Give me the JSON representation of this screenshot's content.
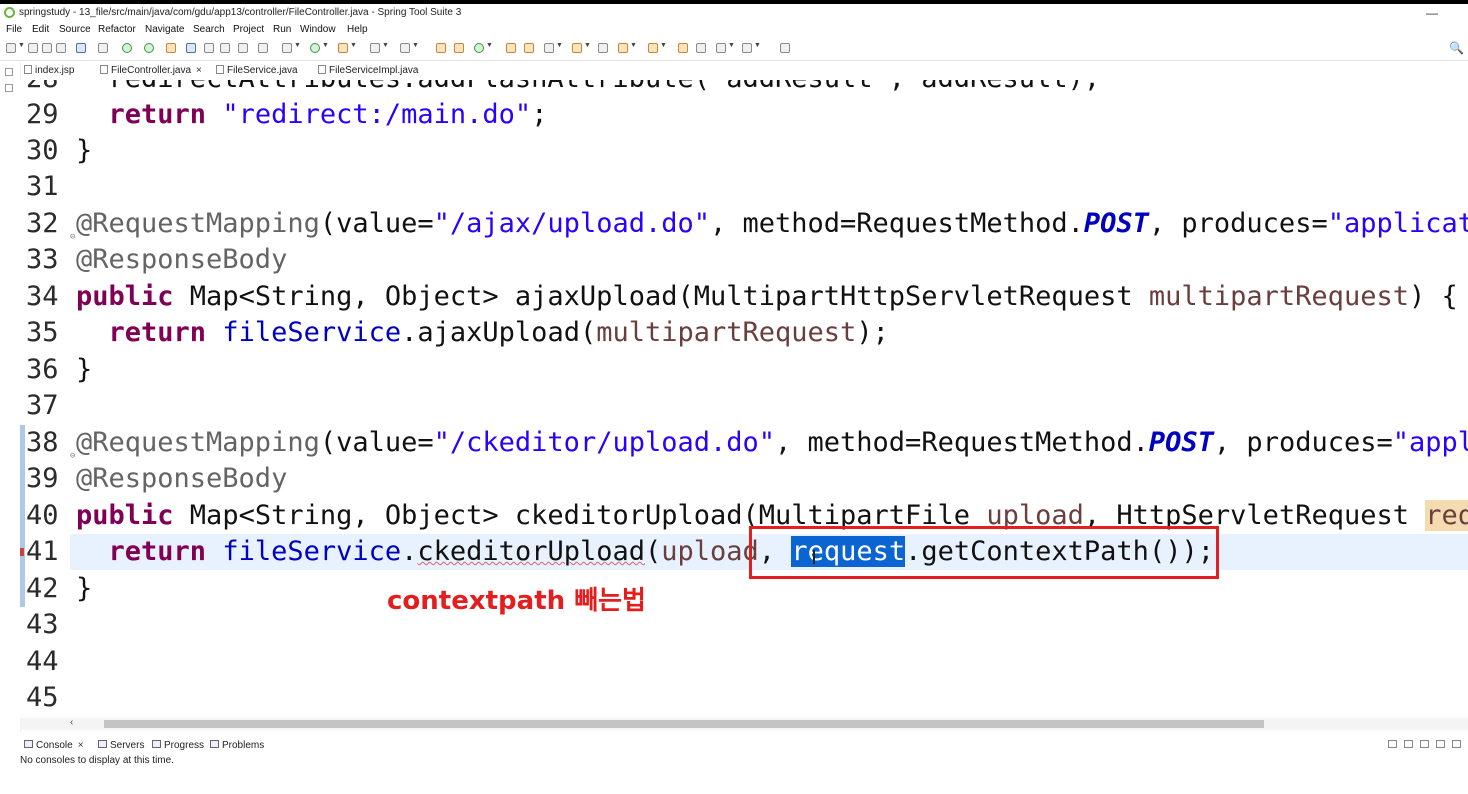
{
  "window": {
    "title": "springstudy - 13_file/src/main/java/com/gdu/app13/controller/FileController.java - Spring Tool Suite 3",
    "minimize_glyph": "—"
  },
  "menu": [
    "File",
    "Edit",
    "Source",
    "Refactor",
    "Navigate",
    "Search",
    "Project",
    "Run",
    "Window",
    "Help"
  ],
  "tabs": [
    {
      "label": "index.jsp",
      "active": false,
      "closable": false
    },
    {
      "label": "FileController.java",
      "active": true,
      "closable": true
    },
    {
      "label": "FileService.java",
      "active": false,
      "closable": false
    },
    {
      "label": "FileServiceImpl.java",
      "active": false,
      "closable": false
    }
  ],
  "tab_close_glyph": "×",
  "editor": {
    "lines": [
      {
        "n": "28",
        "t": "  redirectAttributes.addFlashAttribute(\"addResult\", addResult);"
      },
      {
        "n": "29",
        "t": "  return \"redirect:/main.do\";"
      },
      {
        "n": "30",
        "t": "}"
      },
      {
        "n": "31",
        "t": ""
      },
      {
        "n": "32",
        "t": "@RequestMapping(value=\"/ajax/upload.do\", method=RequestMethod.POST, produces=\"applicatio"
      },
      {
        "n": "33",
        "t": "@ResponseBody"
      },
      {
        "n": "34",
        "t": "public Map<String, Object> ajaxUpload(MultipartHttpServletRequest multipartRequest) {"
      },
      {
        "n": "35",
        "t": "  return fileService.ajaxUpload(multipartRequest);"
      },
      {
        "n": "36",
        "t": "}"
      },
      {
        "n": "37",
        "t": ""
      },
      {
        "n": "38",
        "t": "@RequestMapping(value=\"/ckeditor/upload.do\", method=RequestMethod.POST, produces=\"applic"
      },
      {
        "n": "39",
        "t": "@ResponseBody"
      },
      {
        "n": "40",
        "t": "public Map<String, Object> ckeditorUpload(MultipartFile upload, HttpServletRequest reque"
      },
      {
        "n": "41",
        "t": "  return fileService.ckeditorUpload(upload, request.getContextPath());"
      },
      {
        "n": "42",
        "t": "}"
      },
      {
        "n": "43",
        "t": ""
      },
      {
        "n": "44",
        "t": ""
      },
      {
        "n": "45",
        "t": ""
      }
    ]
  },
  "annotation": {
    "text": "contextpath 빼는법"
  },
  "bottom_tabs": [
    {
      "label": "Console",
      "closable": true
    },
    {
      "label": "Servers",
      "closable": false
    },
    {
      "label": "Progress",
      "closable": false
    },
    {
      "label": "Problems",
      "closable": false
    }
  ],
  "console_message": "No consoles to display at this time.",
  "scroll_left_glyph": "‹",
  "search_glyph": "🔍",
  "colors": {
    "keyword": "#7f0055",
    "string": "#2a00ff",
    "annotation": "#646464",
    "field": "#0000c0",
    "parameter": "#6a3e3e",
    "selection": "#0a64d2",
    "annotation_red": "#e41e1e"
  }
}
